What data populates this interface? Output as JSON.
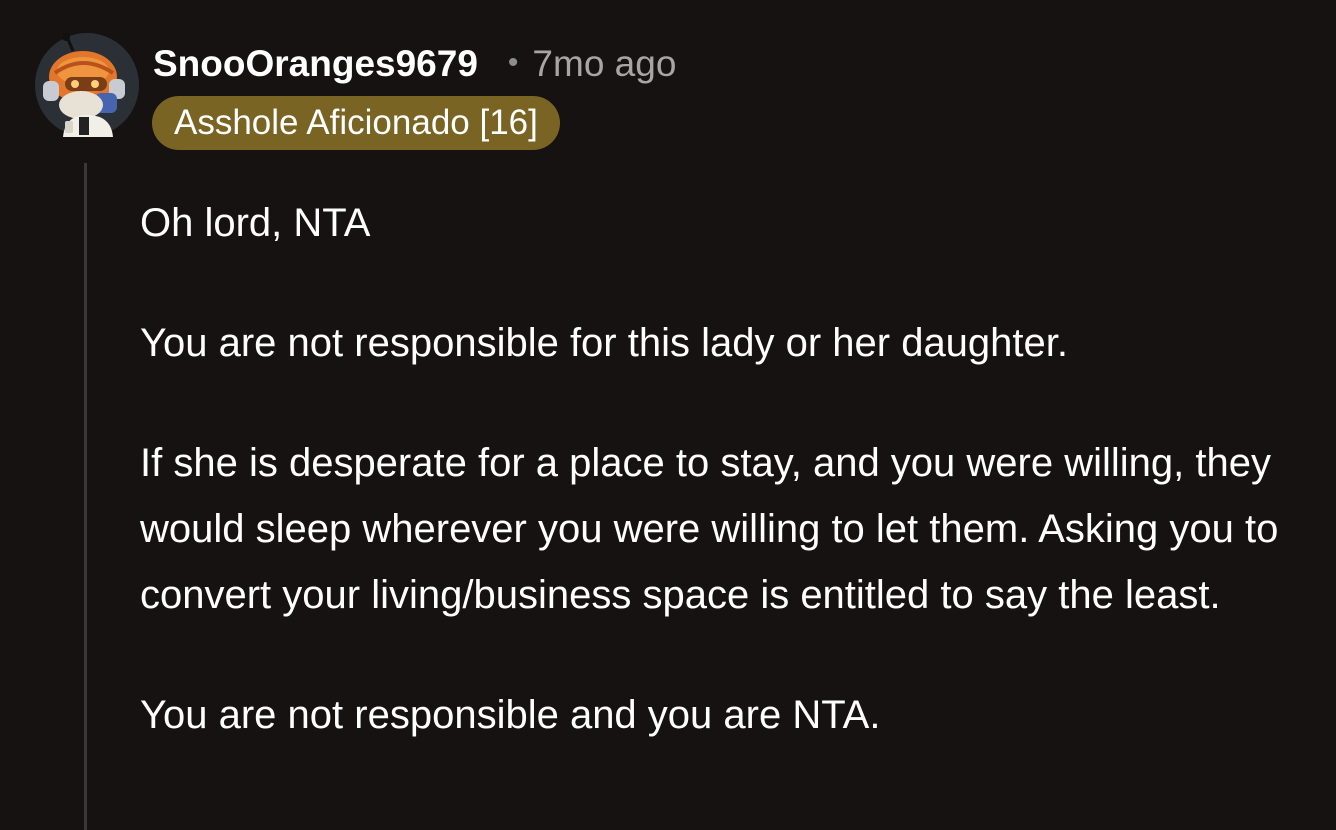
{
  "comment": {
    "username": "SnooOranges9679",
    "separator": "•",
    "timestamp": "7mo ago",
    "flair": "Asshole Aficionado [16]",
    "avatar_icon": "snoo-avatar-icon",
    "paragraphs": [
      "Oh lord, NTA",
      "You are not responsible for this lady or her daughter.",
      "If she is desperate for a place to stay, and you were willing, they would sleep wherever you were willing to let them. Asking you to convert your living/business space is entitled to say the least.",
      "You are not responsible and you are NTA."
    ]
  },
  "colors": {
    "background": "#161211",
    "flair_background": "#7a6424",
    "text": "#ffffff",
    "muted_text": "#a8a5a3",
    "thread_line": "#3a3736"
  }
}
